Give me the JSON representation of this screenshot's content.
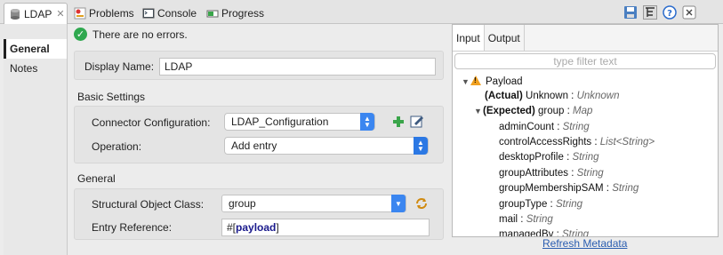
{
  "tabs": [
    {
      "label": "LDAP",
      "icon": "database-icon",
      "active": true,
      "closable": true
    },
    {
      "label": "Problems",
      "icon": "problems-icon"
    },
    {
      "label": "Console",
      "icon": "console-icon"
    },
    {
      "label": "Progress",
      "icon": "progress-icon"
    }
  ],
  "toolbar_icons": [
    "save-icon",
    "outline-icon",
    "help-icon",
    "close-icon"
  ],
  "nav": {
    "items": [
      "General",
      "Notes"
    ],
    "selected": "General"
  },
  "status": {
    "text": "There are no errors."
  },
  "form": {
    "display_name_label": "Display Name:",
    "display_name_value": "LDAP",
    "basic_settings_title": "Basic Settings",
    "connector_label": "Connector Configuration:",
    "connector_value": "LDAP_Configuration",
    "operation_label": "Operation:",
    "operation_value": "Add entry",
    "general_title": "General",
    "object_class_label": "Structural Object Class:",
    "object_class_value": "group",
    "entry_ref_label": "Entry Reference:",
    "entry_ref_prefix": "#[",
    "entry_ref_keyword": "payload",
    "entry_ref_suffix": "]"
  },
  "metadata": {
    "tabs": [
      "Input",
      "Output"
    ],
    "active_tab": "Input",
    "filter_placeholder": "type filter text",
    "tree": [
      {
        "label": "Payload",
        "type": "",
        "level": 0,
        "expanded": true,
        "warning": true
      },
      {
        "label": "(Actual)",
        "name": "Unknown",
        "type": "Unknown",
        "level": 1
      },
      {
        "label": "(Expected)",
        "name": "group",
        "type": "Map",
        "level": 1,
        "expanded": true
      },
      {
        "name": "adminCount",
        "type": "String",
        "level": 2
      },
      {
        "name": "controlAccessRights",
        "type": "List<String>",
        "level": 2
      },
      {
        "name": "desktopProfile",
        "type": "String",
        "level": 2
      },
      {
        "name": "groupAttributes",
        "type": "String",
        "level": 2
      },
      {
        "name": "groupMembershipSAM",
        "type": "String",
        "level": 2
      },
      {
        "name": "groupType",
        "type": "String",
        "level": 2
      },
      {
        "name": "mail",
        "type": "String",
        "level": 2
      },
      {
        "name": "managedBy",
        "type": "String",
        "level": 2
      }
    ],
    "refresh_label": "Refresh Metadata"
  },
  "colors": {
    "accent": "#3b86f0",
    "ok": "#2fa84f",
    "warning": "#f0a020",
    "link": "#2a5db0",
    "keyword": "#1a1a8c"
  }
}
